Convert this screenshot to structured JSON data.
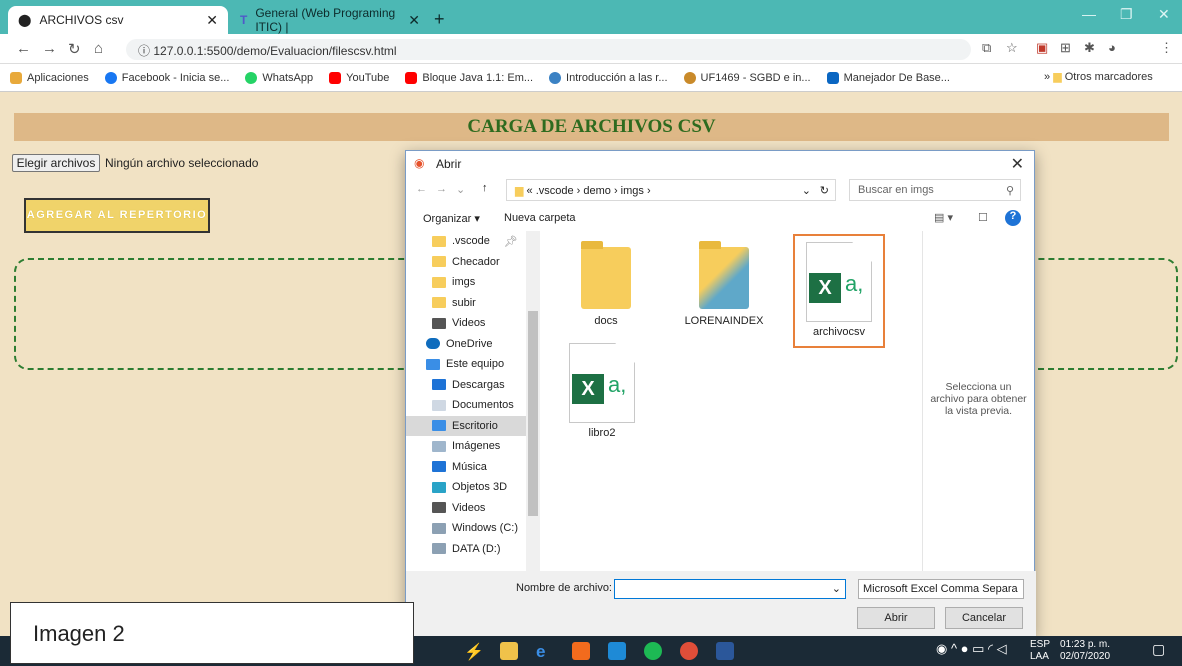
{
  "browser": {
    "tabs": [
      {
        "title": "ARCHIVOS csv"
      },
      {
        "title": "General (Web Programing ITIC) |"
      }
    ],
    "url": "127.0.0.1:5500/demo/Evaluacion/filescsv.html",
    "bookmarks": [
      {
        "label": "Aplicaciones",
        "color": "#e8a93b"
      },
      {
        "label": "Facebook - Inicia se...",
        "color": "#1877f2"
      },
      {
        "label": "WhatsApp",
        "color": "#25d366"
      },
      {
        "label": "YouTube",
        "color": "#ff0000"
      },
      {
        "label": "Bloque Java 1.1: Em...",
        "color": "#ff0000"
      },
      {
        "label": "Introducción a las r...",
        "color": "#3b82c4"
      },
      {
        "label": "UF1469 - SGBD e in...",
        "color": "#c98a2a"
      },
      {
        "label": "Manejador De Base...",
        "color": "#0a66c2"
      }
    ],
    "other_bookmarks": "Otros marcadores"
  },
  "page": {
    "title": "CARGA DE ARCHIVOS CSV",
    "file_button": "Elegir archivos",
    "no_file": "Ningún archivo seleccionado",
    "add_button": "AGREGAR AL REPERTORIO"
  },
  "dialog": {
    "title": "Abrir",
    "breadcrumb": "« .vscode › demo › imgs ›",
    "search_placeholder": "Buscar en imgs",
    "organize": "Organizar ▾",
    "new_folder": "Nueva carpeta",
    "nav_items": [
      {
        "label": ".vscode",
        "icon": "folder-icon"
      },
      {
        "label": "Checador",
        "icon": "folder-icon"
      },
      {
        "label": "imgs",
        "icon": "folder-icon"
      },
      {
        "label": "subir",
        "icon": "folder-icon"
      },
      {
        "label": "Videos",
        "icon": "video-icon"
      },
      {
        "label": "OneDrive",
        "icon": "cloud-icon"
      },
      {
        "label": "Este equipo",
        "icon": "computer-icon"
      },
      {
        "label": "Descargas",
        "icon": "download-icon"
      },
      {
        "label": "Documentos",
        "icon": "document-icon"
      },
      {
        "label": "Escritorio",
        "icon": "desktop-icon"
      },
      {
        "label": "Imágenes",
        "icon": "image-icon"
      },
      {
        "label": "Música",
        "icon": "music-icon"
      },
      {
        "label": "Objetos 3D",
        "icon": "cube-icon"
      },
      {
        "label": "Videos",
        "icon": "video-icon"
      },
      {
        "label": "Windows (C:)",
        "icon": "drive-icon"
      },
      {
        "label": "DATA (D:)",
        "icon": "drive-icon"
      }
    ],
    "files": [
      {
        "name": "docs",
        "type": "folder"
      },
      {
        "name": "LORENAINDEX",
        "type": "folder"
      },
      {
        "name": "archivocsv",
        "type": "excel",
        "selected": true
      },
      {
        "name": "libro2",
        "type": "excel"
      }
    ],
    "preview_text": "Selecciona un archivo para obtener la vista previa.",
    "file_name_label": "Nombre de archivo:",
    "file_name_value": "",
    "file_type": "Microsoft Excel Comma Separa",
    "open_button": "Abrir",
    "cancel_button": "Cancelar"
  },
  "caption": "Imagen 2",
  "taskbar": {
    "lang1": "ESP",
    "lang2": "LAA",
    "time": "01:23 p. m.",
    "date": "02/07/2020"
  }
}
